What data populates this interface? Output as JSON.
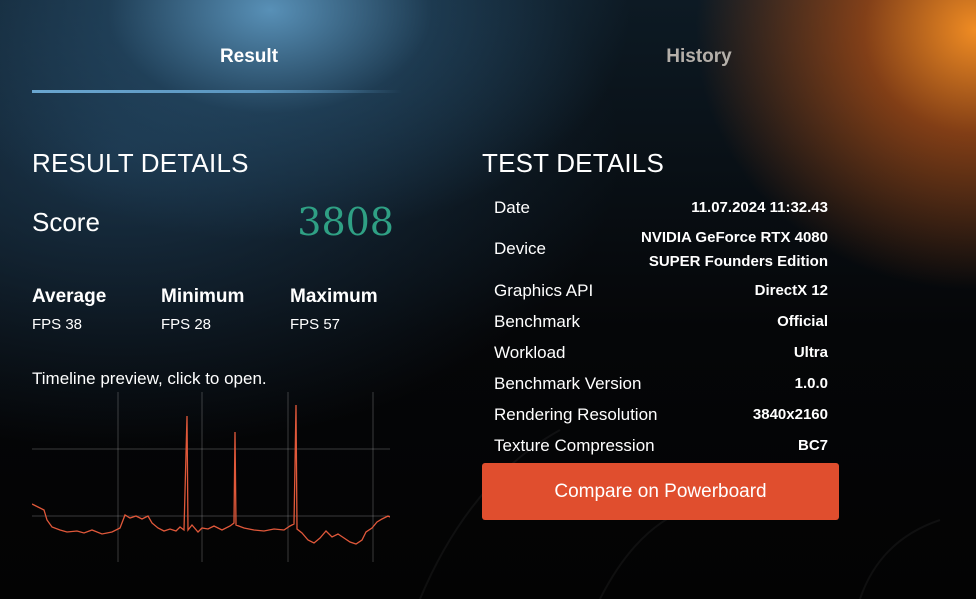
{
  "tabs": {
    "result": "Result",
    "history": "History"
  },
  "result": {
    "title": "RESULT DETAILS",
    "score_label": "Score",
    "score_value": "3808",
    "stats": [
      {
        "name": "Average",
        "value": "FPS 38"
      },
      {
        "name": "Minimum",
        "value": "FPS 28"
      },
      {
        "name": "Maximum",
        "value": "FPS 57"
      }
    ],
    "timeline_caption": "Timeline preview, click to open."
  },
  "test": {
    "title": "TEST DETAILS",
    "rows": [
      {
        "label": "Date",
        "value": "11.07.2024 11:32.43"
      },
      {
        "label": "Device",
        "value_line1": "NVIDIA GeForce RTX 4080",
        "value_line2": "SUPER Founders Edition"
      },
      {
        "label": "Graphics API",
        "value": "DirectX 12"
      },
      {
        "label": "Benchmark",
        "value": "Official"
      },
      {
        "label": "Workload",
        "value": "Ultra"
      },
      {
        "label": "Benchmark Version",
        "value": "1.0.0"
      },
      {
        "label": "Rendering Resolution",
        "value": "3840x2160"
      },
      {
        "label": "Texture Compression",
        "value": "BC7"
      }
    ],
    "compare_button": "Compare on Powerboard"
  },
  "colors": {
    "score": "#2fa084",
    "timeline_line": "#e0583a",
    "button": "#e04e2e",
    "tab_underline": "#6aa6d0"
  }
}
